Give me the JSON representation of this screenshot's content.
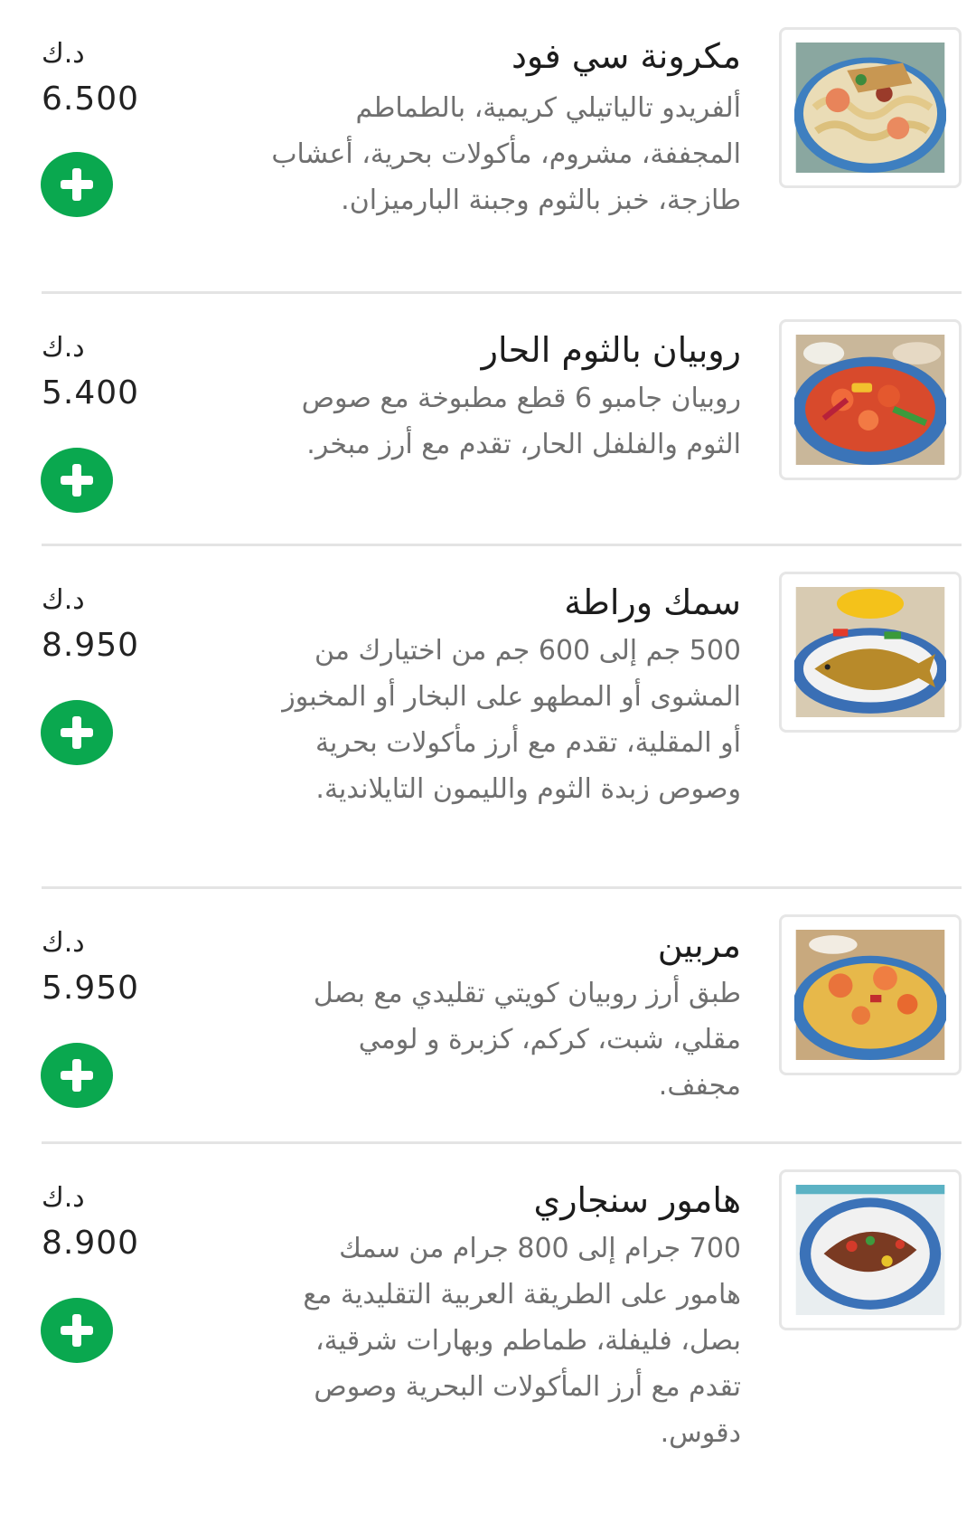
{
  "menu_items": [
    {
      "name": "مكرونة سي فود",
      "description": "ألفريدو تالياتيلي كريمية، بالطماطم المجففة، مشروم، مأكولات بحرية، أعشاب طازجة، خبز بالثوم وجبنة البارميزان.",
      "currency": "د.ك",
      "price": "6.500",
      "image": "seafood-pasta-photo"
    },
    {
      "name": "روبيان بالثوم الحار",
      "description": "روبيان جامبو 6 قطع مطبوخة مع صوص الثوم والفلفل الحار، تقدم مع أرز مبخر.",
      "currency": "د.ك",
      "price": "5.400",
      "image": "garlic-shrimp-photo"
    },
    {
      "name": "سمك وراطة",
      "description": "500 جم إلى 600 جم من اختيارك من المشوى أو المطهو على البخار أو المخبوز أو المقلية، تقدم مع أرز مأكولات بحرية وصوص زبدة الثوم والليمون التايلاندية.",
      "currency": "د.ك",
      "price": "8.950",
      "image": "fish-photo"
    },
    {
      "name": "مربين",
      "description": "طبق أرز روبيان كويتي تقليدي مع بصل مقلي، شبت، كركم، كزبرة و لومي مجفف.",
      "currency": "د.ك",
      "price": "5.950",
      "image": "shrimp-rice-photo"
    },
    {
      "name": "هامور سنجاري",
      "description": "700 جرام إلى 800 جرام من سمك هامور على الطريقة العربية التقليدية مع بصل، فليفلة، طماطم وبهارات شرقية، تقدم مع أرز المأكولات البحرية وصوص دقوس.",
      "currency": "د.ك",
      "price": "8.900",
      "image": "hamour-photo"
    }
  ],
  "colors": {
    "accent": "#0aa84f",
    "divider": "#e4e4e4",
    "description_text": "#6f6f6f"
  }
}
